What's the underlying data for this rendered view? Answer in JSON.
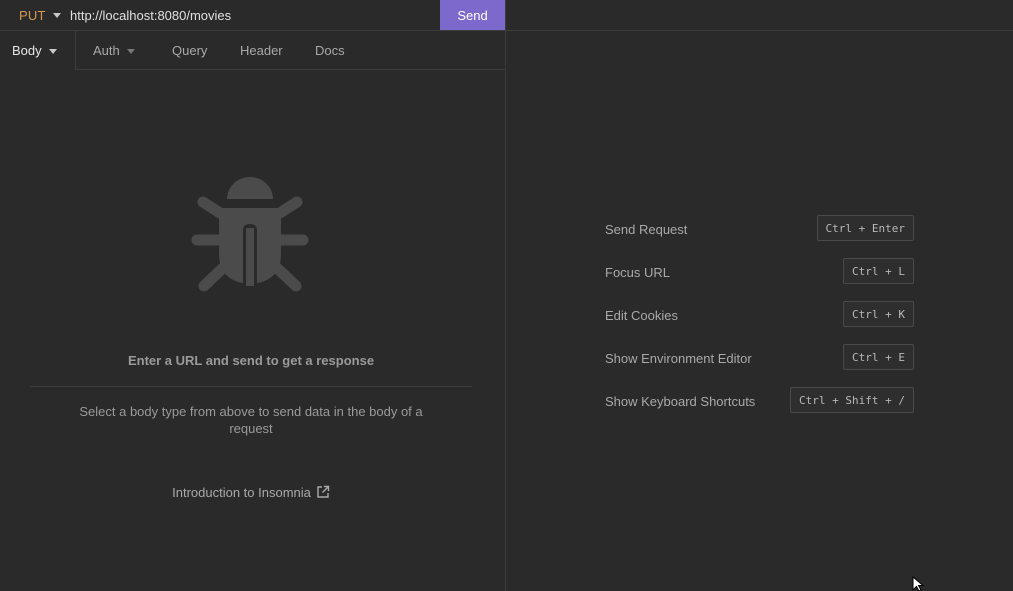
{
  "request": {
    "method": "PUT",
    "url": "http://localhost:8080/movies",
    "send_label": "Send"
  },
  "tabs": [
    {
      "label": "Body",
      "has_dropdown": true,
      "active": true
    },
    {
      "label": "Auth",
      "has_dropdown": true,
      "active": false
    },
    {
      "label": "Query",
      "has_dropdown": false,
      "active": false
    },
    {
      "label": "Header",
      "has_dropdown": false,
      "active": false
    },
    {
      "label": "Docs",
      "has_dropdown": false,
      "active": false
    }
  ],
  "empty_state": {
    "icon": "bug-icon",
    "title": "Enter a URL and send to get a response",
    "description": "Select a body type from above to send data in the body of a request",
    "link_label": "Introduction to Insomnia"
  },
  "shortcuts": [
    {
      "label": "Send Request",
      "keys": "Ctrl + Enter"
    },
    {
      "label": "Focus URL",
      "keys": "Ctrl + L"
    },
    {
      "label": "Edit Cookies",
      "keys": "Ctrl + K"
    },
    {
      "label": "Show Environment Editor",
      "keys": "Ctrl + E"
    },
    {
      "label": "Show Keyboard Shortcuts",
      "keys": "Ctrl + Shift + /"
    }
  ],
  "colors": {
    "background": "#2a2a2a",
    "accent": "#7d69cb",
    "method": "#d29a53"
  }
}
